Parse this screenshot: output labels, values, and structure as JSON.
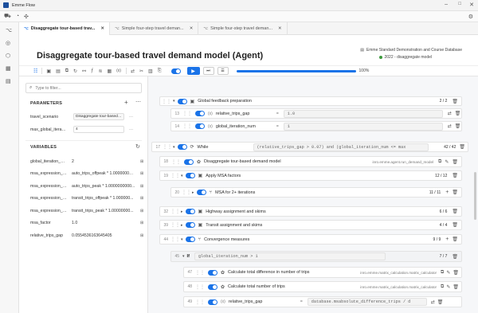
{
  "app": {
    "title": "Emme Flow"
  },
  "tabs": [
    {
      "label": "Disaggregate tour-based trav...",
      "active": true
    },
    {
      "label": "Simple four-step travel deman...",
      "active": false
    },
    {
      "label": "Simple four-step travel deman...",
      "active": false
    }
  ],
  "header": {
    "title": "Disaggregate tour-based travel demand model (Agent)",
    "database": "Emme Standard Demonstration and Course Database",
    "scenario": "2022 - disaggregate model"
  },
  "toolbar": {
    "progress": "100%",
    "progress_fraction": 1.0
  },
  "filter": {
    "placeholder": "Type to filter..."
  },
  "parameters": {
    "title": "PARAMETERS",
    "items": [
      {
        "key": "travel_scenario",
        "value": "Disaggregate tour-based sce"
      },
      {
        "key": "max_global_iteratio...",
        "value": "4"
      }
    ]
  },
  "variables": {
    "title": "VARIABLES",
    "items": [
      {
        "key": "global_iteration_nu...",
        "value": "2"
      },
      {
        "key": "msa_expression_au...",
        "value": "auto_trips_offpeak * 1.000000000..."
      },
      {
        "key": "msa_expression_au...",
        "value": "auto_trips_peak * 1.0000000000..."
      },
      {
        "key": "msa_expression_tr...",
        "value": "transit_trips_offpeak * 1.000000..."
      },
      {
        "key": "msa_expression_tr...",
        "value": "transit_trips_peak * 1.00000000..."
      },
      {
        "key": "msa_factor",
        "value": "1.0"
      },
      {
        "key": "relative_trips_gap",
        "value": "0.0554536163645405"
      }
    ]
  },
  "flow": {
    "global_feedback": {
      "label": "Global feedback preparation",
      "count": "2 / 2"
    },
    "row13": {
      "num": "13",
      "name": "relative_trips_gap",
      "value": "1.0"
    },
    "row14": {
      "num": "14",
      "name": "global_iteration_num",
      "value": "1"
    },
    "while": {
      "num": "17",
      "label": "While",
      "condition": "(relative_trips_gap > 0.07) and (global_iteration_num <= max",
      "count": "42 / 42"
    },
    "row18": {
      "num": "18",
      "label": "Disaggregate tour-based demand model",
      "ref": "inro.emme.agent.run_demand_model"
    },
    "row19": {
      "num": "19",
      "label": "Apply MSA factors",
      "count": "12 / 12"
    },
    "row20": {
      "num": "20",
      "label": "MSA for 2+ iterations",
      "count": "11 / 11"
    },
    "row32": {
      "num": "32",
      "label": "Highway assignment and skims",
      "count": "6 / 6"
    },
    "row39": {
      "num": "39",
      "label": "Transit assignment and skims",
      "count": "4 / 4"
    },
    "row44": {
      "num": "44",
      "label": "Convergence measures",
      "count": "9 / 9"
    },
    "row45": {
      "num": "45",
      "kw": "If",
      "condition": "global_iteration_num > 1",
      "count": "7 / 7"
    },
    "row47": {
      "num": "47",
      "label": "Calculate total difference in number of trips",
      "ref": "inro.emme.matrix_calculation.matrix_calculator"
    },
    "row48": {
      "num": "48",
      "label": "Calculate total number of trips",
      "ref": "inro.emme.matrix_calculation.matrix_calculator"
    },
    "row49": {
      "num": "49",
      "name": "relative_trips_gap",
      "value": "database.msabsolute_difference_trips / d"
    }
  }
}
